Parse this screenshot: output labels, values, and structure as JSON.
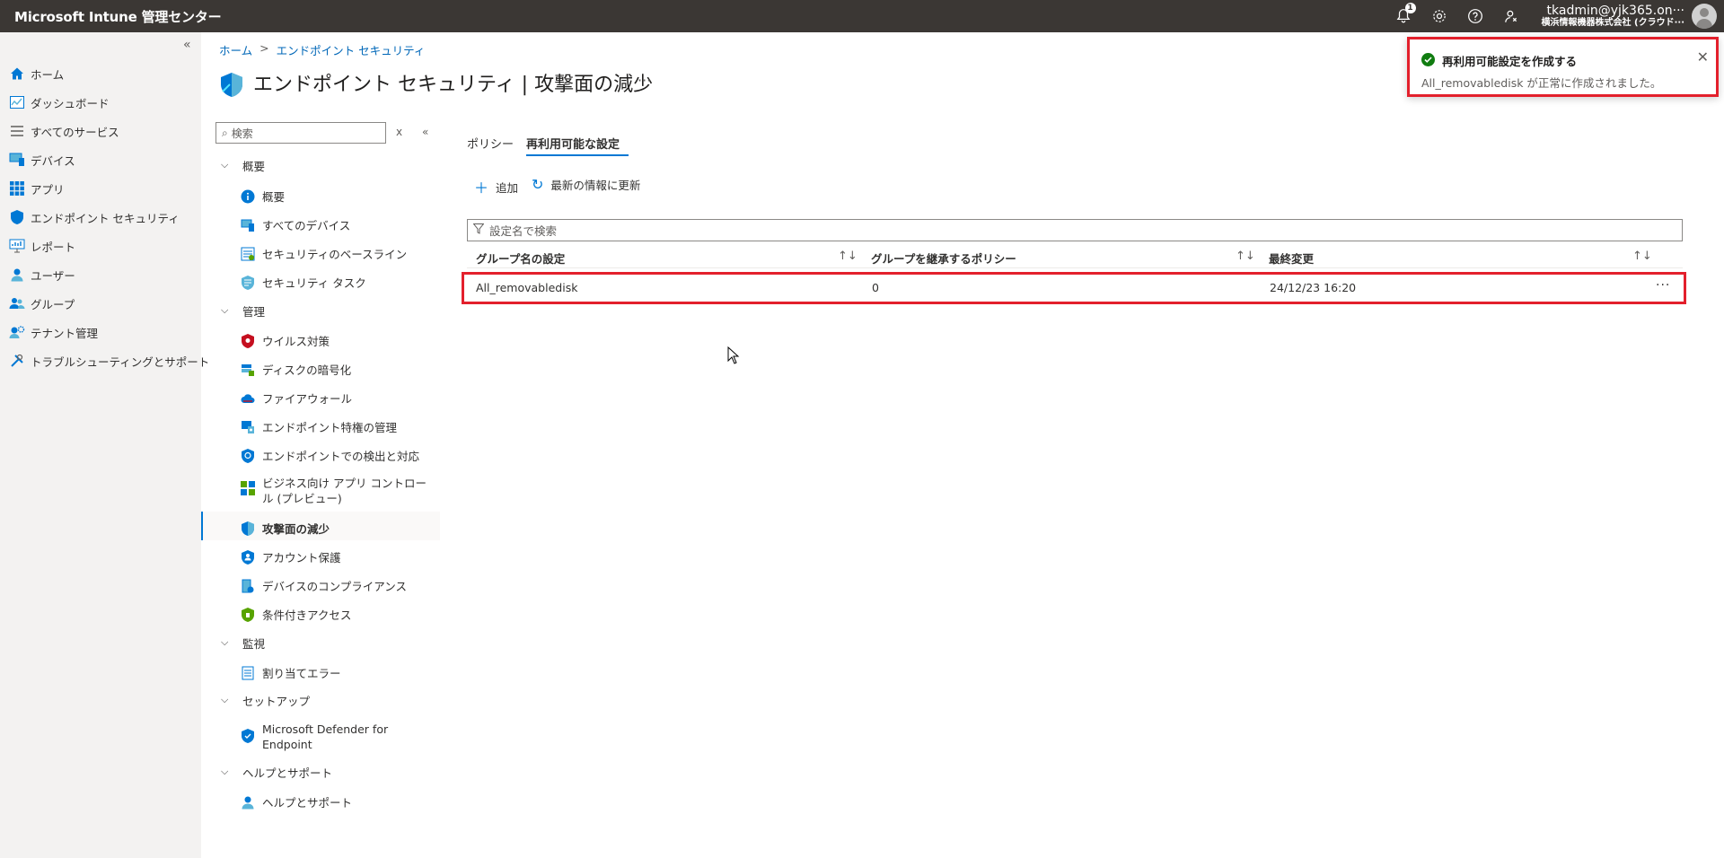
{
  "topbar": {
    "brand": "Microsoft Intune 管理センター",
    "notification_count": "1",
    "user": "tkadmin@yjk365.on···",
    "tenant": "横浜情報機器株式会社 (クラウド···"
  },
  "nav": {
    "collapse": "«",
    "items": [
      {
        "label": "ホーム",
        "icon": "home-icon"
      },
      {
        "label": "ダッシュボード",
        "icon": "dashboard-icon"
      },
      {
        "label": "すべてのサービス",
        "icon": "list-icon"
      },
      {
        "label": "デバイス",
        "icon": "device-icon"
      },
      {
        "label": "アプリ",
        "icon": "apps-grid-icon"
      },
      {
        "label": "エンドポイント セキュリティ",
        "icon": "shield-icon"
      },
      {
        "label": "レポート",
        "icon": "report-icon"
      },
      {
        "label": "ユーザー",
        "icon": "user-icon"
      },
      {
        "label": "グループ",
        "icon": "group-icon"
      },
      {
        "label": "テナント管理",
        "icon": "tenant-admin-icon"
      },
      {
        "label": "トラブルシューティングとサポート",
        "icon": "wrench-icon"
      }
    ]
  },
  "breadcrumb": {
    "home": "ホーム",
    "sep": ">",
    "current": "エンドポイント セキュリティ"
  },
  "page": {
    "title": "エンドポイント セキュリティ | 攻撃面の減少",
    "more": "···"
  },
  "menu": {
    "search_placeholder": "検索",
    "clear": "x",
    "collapse": "«",
    "sections": [
      {
        "label": "概要"
      },
      {
        "label": "管理"
      },
      {
        "label": "監視"
      },
      {
        "label": "セットアップ"
      },
      {
        "label": "ヘルプとサポート"
      }
    ],
    "items": {
      "overview": "概要",
      "all_devices": "すべてのデバイス",
      "baselines": "セキュリティのベースライン",
      "tasks": "セキュリティ タスク",
      "antivirus": "ウイルス対策",
      "disk_encryption": "ディスクの暗号化",
      "firewall": "ファイアウォール",
      "epm": "エンドポイント特権の管理",
      "edr": "エンドポイントでの検出と対応",
      "app_control_1": "ビジネス向け アプリ コントロー",
      "app_control_2": "ル (プレビュー)",
      "asr": "攻撃面の減少",
      "account_protection": "アカウント保護",
      "compliance": "デバイスのコンプライアンス",
      "conditional_access": "条件付きアクセス",
      "assignment_errors": "割り当てエラー",
      "defender_1": "Microsoft Defender for",
      "defender_2": "Endpoint",
      "help": "ヘルプとサポート"
    }
  },
  "tabs": {
    "policy": "ポリシー",
    "reusable": "再利用可能な設定"
  },
  "commands": {
    "add": "追加",
    "refresh": "最新の情報に更新"
  },
  "filter": {
    "placeholder": "設定名で検索"
  },
  "table": {
    "headers": [
      "グループ名の設定",
      "グループを継承するポリシー",
      "最終変更"
    ],
    "sort": "↑↓",
    "rows": [
      {
        "name": "All_removabledisk",
        "policies": "0",
        "modified": "24/12/23 16:20",
        "more": "···"
      }
    ]
  },
  "toast": {
    "title": "再利用可能設定を作成する",
    "message": "All_removabledisk が正常に作成されました。",
    "close": "✕"
  }
}
